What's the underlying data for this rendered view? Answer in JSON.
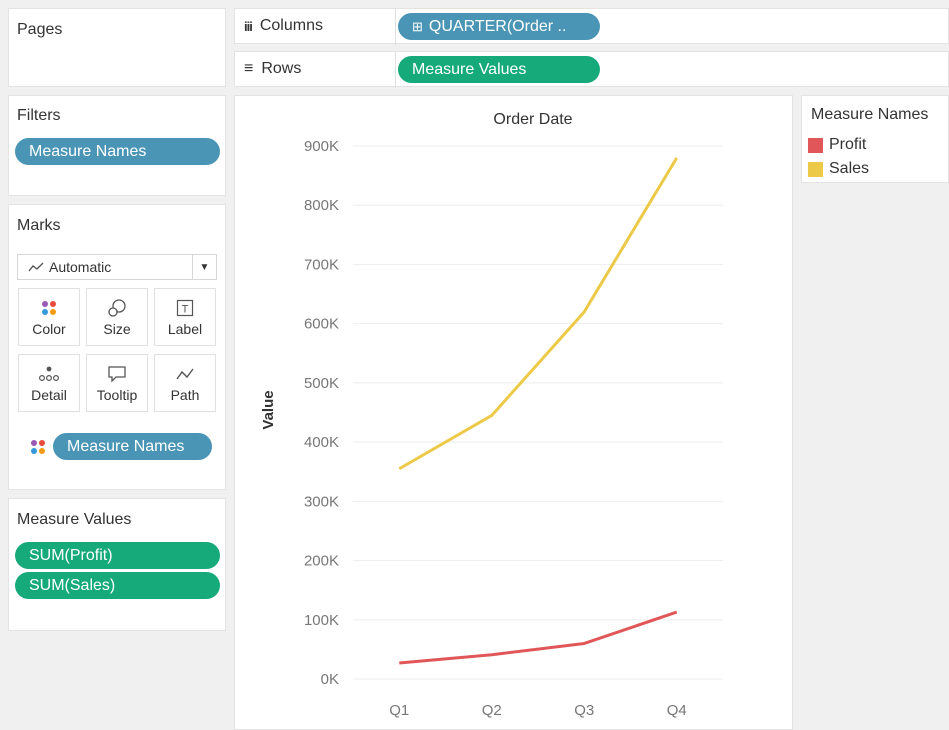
{
  "pages": {
    "title": "Pages"
  },
  "columns_shelf": {
    "label": "Columns",
    "pill": "QUARTER(Order .."
  },
  "rows_shelf": {
    "label": "Rows",
    "pill": "Measure Values"
  },
  "filters": {
    "title": "Filters",
    "pills": [
      "Measure Names"
    ]
  },
  "marks": {
    "title": "Marks",
    "mark_type": "Automatic",
    "buttons": [
      "Color",
      "Size",
      "Label",
      "Detail",
      "Tooltip",
      "Path"
    ],
    "color_pill": "Measure Names"
  },
  "measure_values": {
    "title": "Measure Values",
    "pills": [
      "SUM(Profit)",
      "SUM(Sales)"
    ]
  },
  "legend": {
    "title": "Measure Names",
    "items": [
      {
        "name": "Profit",
        "color": "#e15759"
      },
      {
        "name": "Sales",
        "color": "#edc948"
      }
    ]
  },
  "chart_data": {
    "type": "line",
    "title": "Order Date",
    "xlabel": "",
    "ylabel": "Value",
    "categories": [
      "Q1",
      "Q2",
      "Q3",
      "Q4"
    ],
    "ylim": [
      0,
      900000
    ],
    "yticks": [
      "0K",
      "100K",
      "200K",
      "300K",
      "400K",
      "500K",
      "600K",
      "700K",
      "800K",
      "900K"
    ],
    "grid": true,
    "series": [
      {
        "name": "Profit",
        "color": "#e15759",
        "values": [
          27000,
          41000,
          60000,
          113000
        ]
      },
      {
        "name": "Sales",
        "color": "#edc948",
        "values": [
          355000,
          445000,
          620000,
          880000
        ]
      }
    ]
  }
}
